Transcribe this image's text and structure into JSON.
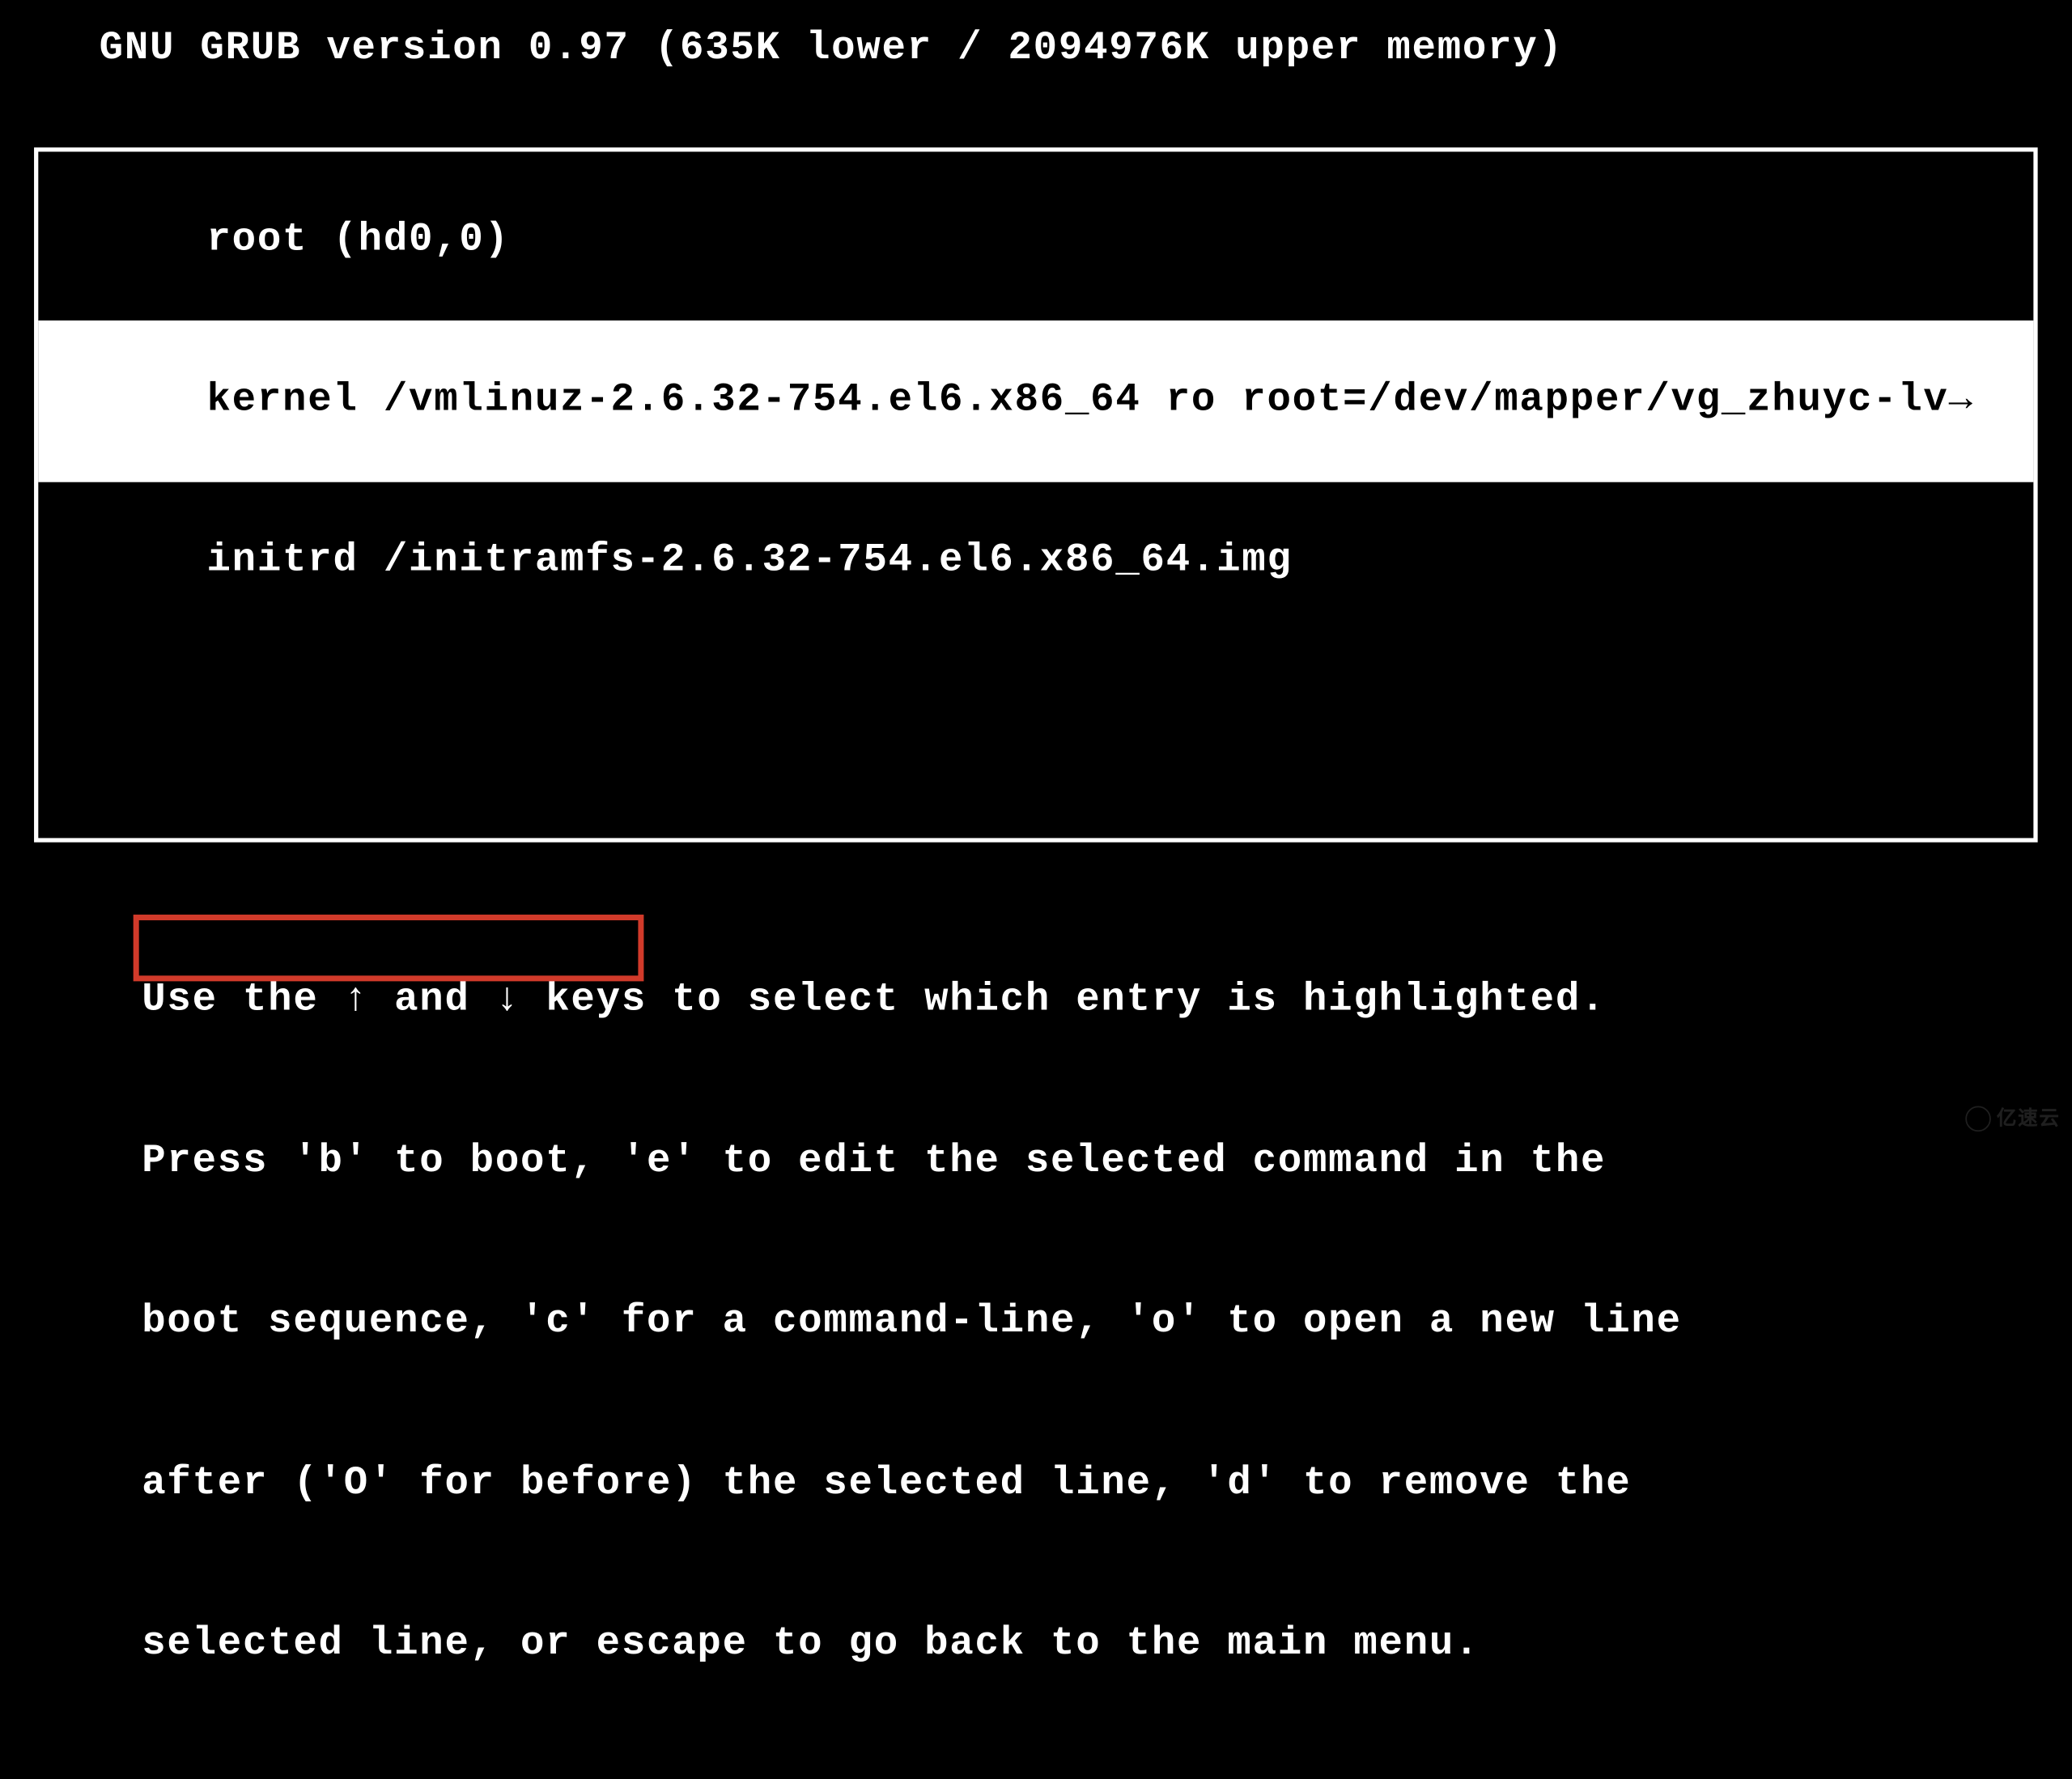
{
  "header": {
    "title": "GNU GRUB  version 0.97  (635K lower / 2094976K upper memory)"
  },
  "menu": {
    "entries": [
      {
        "text": "root (hd0,0)",
        "selected": false
      },
      {
        "text": "kernel /vmlinuz-2.6.32-754.el6.x86_64 ro root=/dev/mapper/vg_zhuyc-lv→",
        "selected": true
      },
      {
        "text": "initrd /initramfs-2.6.32-754.el6.x86_64.img",
        "selected": false
      }
    ]
  },
  "help": {
    "line1": "Use the ↑ and ↓ keys to select which entry is highlighted.",
    "line2": "Press 'b' to boot, 'e' to edit the selected command in the",
    "line3": "boot sequence, 'c' for a command-line, 'o' to open a new line",
    "line4": "after ('O' for before) the selected line, 'd' to remove the",
    "line5": "selected line, or escape to go back to the main menu."
  },
  "annotation": {
    "highlight_text": "Press 'b' to boot,"
  },
  "watermark": {
    "text": "亿速云"
  }
}
